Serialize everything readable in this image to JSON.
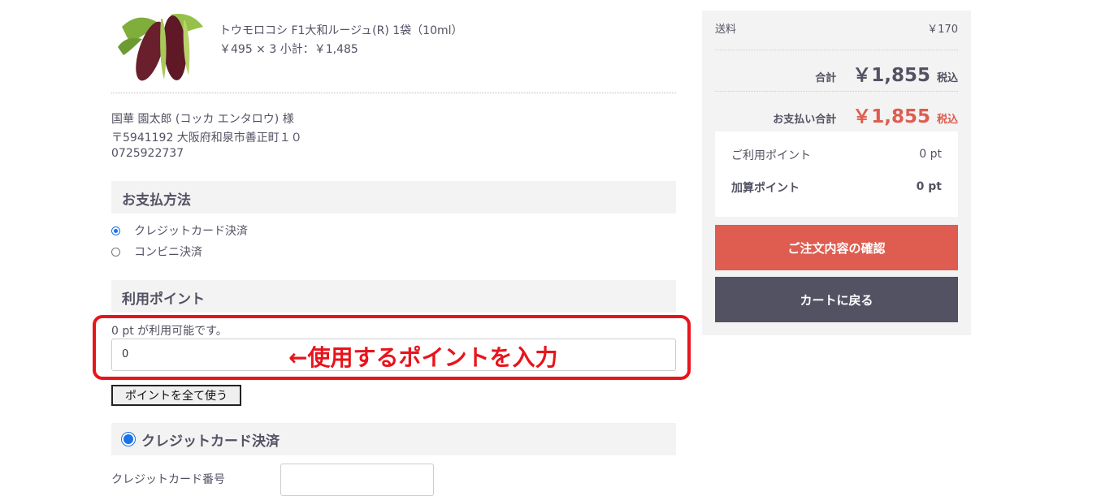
{
  "product": {
    "name": "トウモロコシ F1大和ルージュ(R) 1袋（10ml）",
    "price_line": "￥495 × 3  小計：￥1,485"
  },
  "address": {
    "name": "国華 園太郎 (コッカ エンタロウ) 様",
    "postal_address": "〒5941192 大阪府和泉市善正町１０",
    "phone": "0725922737"
  },
  "payment": {
    "heading": "お支払方法",
    "options": [
      {
        "label": "クレジットカード決済",
        "selected": true
      },
      {
        "label": "コンビニ決済",
        "selected": false
      }
    ]
  },
  "points": {
    "heading": "利用ポイント",
    "available_note": "0 pt が利用可能です。",
    "input_value": "0",
    "use_all_label": "ポイントを全て使う",
    "annotation": "←使用するポイントを入力"
  },
  "credit_card": {
    "heading": "クレジットカード決済",
    "number_label": "クレジットカード番号"
  },
  "summary": {
    "shipping_label": "送料",
    "shipping_value": "￥170",
    "total_label": "合計",
    "total_value": "￥1,855",
    "total_tax": "税込",
    "pay_total_label": "お支払い合計",
    "pay_total_value": "￥1,855",
    "pay_total_tax": "税込",
    "use_points_label": "ご利用ポイント",
    "use_points_value": "0 pt",
    "add_points_label": "加算ポイント",
    "add_points_value": "0 pt",
    "confirm_button": "ご注文内容の確認",
    "back_button": "カートに戻る"
  },
  "colors": {
    "accent_red": "#de5d50",
    "dark_button": "#525263",
    "annotation_red": "#e8141c",
    "radio_blue": "#1a73e8"
  }
}
